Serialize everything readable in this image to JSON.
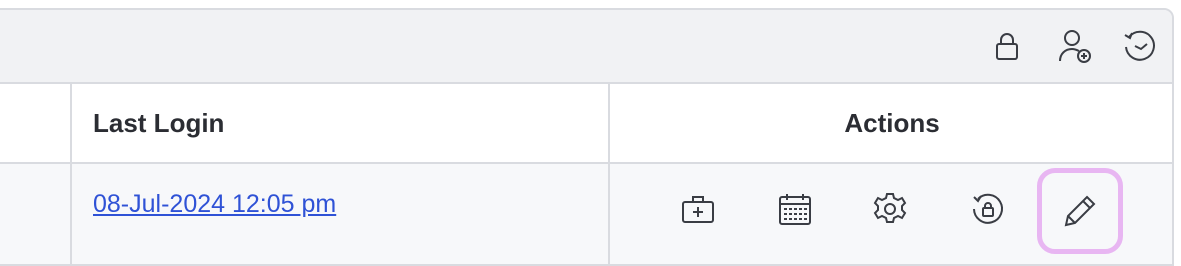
{
  "toolbar": {
    "icons": [
      "lock-icon",
      "add-user-icon",
      "history-icon"
    ]
  },
  "table": {
    "columns": [
      "Last Login",
      "Actions"
    ],
    "rows": [
      {
        "last_login": "08-Jul-2024 12:05 pm",
        "actions": [
          "medical-kit-icon",
          "calendar-icon",
          "gear-icon",
          "reset-lock-icon",
          "pencil-icon"
        ]
      }
    ]
  },
  "colors": {
    "link": "#2f52d6",
    "highlight": "#e8b6f2",
    "border": "#d9dbe0"
  }
}
